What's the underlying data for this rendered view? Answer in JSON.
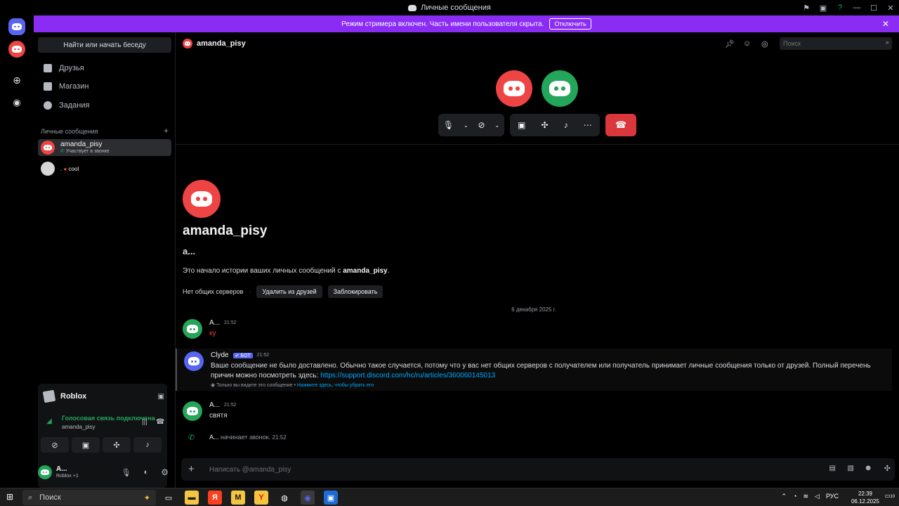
{
  "window": {
    "title": "Личные сообщения"
  },
  "banner": {
    "text": "Режим стримера включен. Часть имени пользователя скрыта.",
    "button": "Отключить"
  },
  "sidebar": {
    "find_button": "Найти или начать беседу",
    "nav": [
      {
        "label": "Друзья",
        "icon": "friends-icon"
      },
      {
        "label": "Магазин",
        "icon": "shop-icon"
      },
      {
        "label": "Задания",
        "icon": "quests-icon"
      }
    ],
    "dm_header": "Личные сообщения",
    "dm_add": "+",
    "dms": [
      {
        "name": "amanda_pisy",
        "status": "Участвует в звонке"
      },
      {
        "name": ".",
        "status": "cool"
      }
    ]
  },
  "voice_panel": {
    "activity": "Roblox",
    "status": "Голосовая связь подключена",
    "channel": "amanda_pisy",
    "user_name": "A...",
    "user_activity": "Roblox +1"
  },
  "header": {
    "channel_name": "amanda_pisy",
    "search_placeholder": "Поиск"
  },
  "welcome": {
    "name": "amanda_pisy",
    "subtitle": "a...",
    "text_prefix": "Это начало истории ваших личных сообщений с",
    "text_name": "amanda_pisy",
    "text_suffix": ".",
    "no_servers": "Нет общих серверов",
    "dot": "·",
    "remove_friend": "Удалить из друзей",
    "block": "Заблокировать"
  },
  "date_divider": "6 декабря 2025 г.",
  "messages": [
    {
      "author": "A...",
      "time": "21:52",
      "text": "ку"
    },
    {
      "author": "Clyde",
      "tag": "БОТ",
      "time": "21:52",
      "text": "Ваше сообщение не было доставлено. Обычно такое случается, потому что у вас нет общих серверов с получателем или получатель принимает личные сообщения только от друзей. Полный перечень причин можно посмотреть здесь:",
      "link": "https://support.discord.com/hc/ru/articles/360060145013",
      "note": "Только вы видите это сообщение •",
      "note_link": "Нажмите здесь, чтобы убрать его"
    },
    {
      "author": "A...",
      "time": "21:52",
      "text": "святя"
    },
    {
      "author": "A...",
      "action": "начинает звонок.",
      "time": "21:52"
    }
  ],
  "composer": {
    "placeholder": "Написать @amanda_pisy"
  },
  "taskbar": {
    "search": "Поиск",
    "lang": "РУС",
    "time": "22:39",
    "date": "06.12.2025",
    "notifications": "10"
  },
  "colors": {
    "accent": "#5865f2",
    "banner": "#8b2cf5",
    "danger": "#da373c",
    "online": "#23a55a"
  }
}
